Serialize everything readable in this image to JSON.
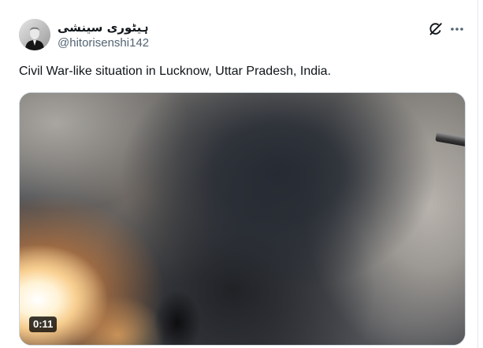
{
  "tweet": {
    "author": {
      "display_name": "ہیٹوری سینشی",
      "handle": "@hitorisenshi142",
      "avatar_icon": "avatar-photo"
    },
    "text": "Civil War-like situation in Lucknow, Uttar Pradesh, India.",
    "media": {
      "type": "video",
      "duration": "0:11"
    },
    "header_icons": [
      "grok-icon",
      "more-options-icon"
    ]
  },
  "colors": {
    "text": "#0f1419",
    "secondary_text": "#536471",
    "border": "#cfd9de",
    "badge_background": "#000000"
  }
}
